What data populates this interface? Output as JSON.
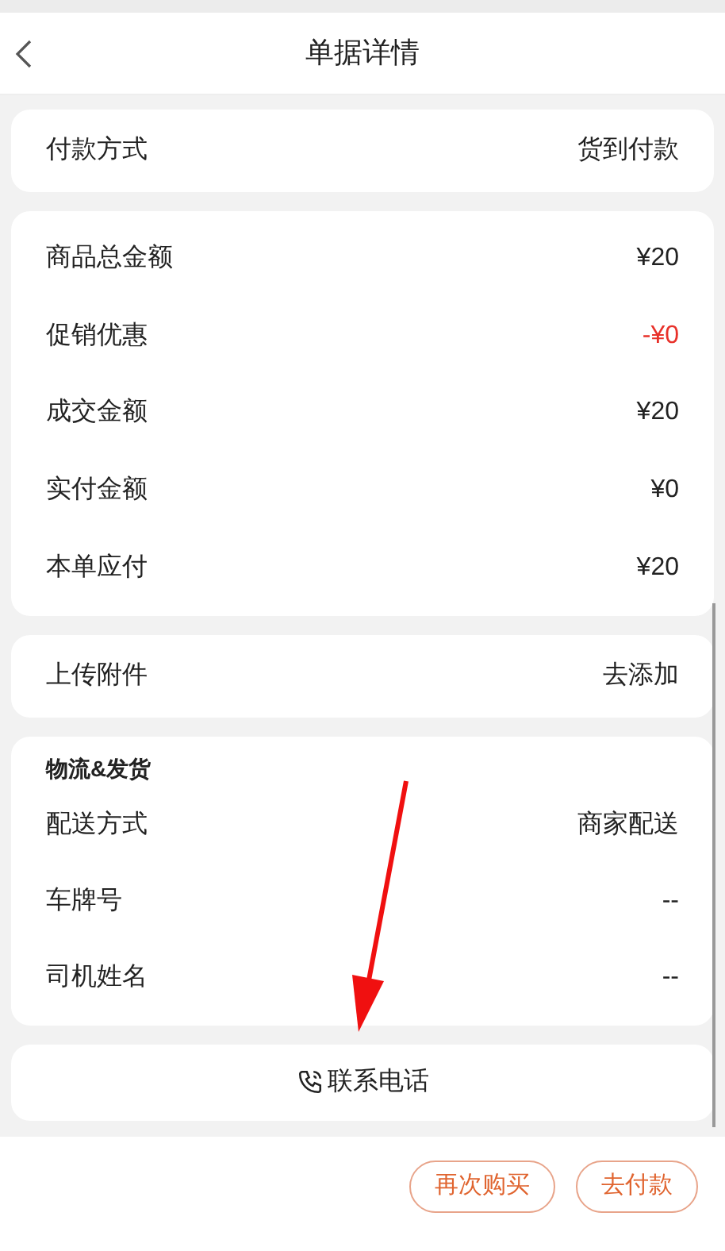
{
  "header": {
    "title": "单据详情"
  },
  "payment": {
    "label": "付款方式",
    "value": "货到付款"
  },
  "amounts": [
    {
      "label": "商品总金额",
      "value": "¥20",
      "kind": "normal"
    },
    {
      "label": "促销优惠",
      "value": "-¥0",
      "kind": "discount"
    },
    {
      "label": "成交金额",
      "value": "¥20",
      "kind": "normal"
    },
    {
      "label": "实付金额",
      "value": "¥0",
      "kind": "normal"
    },
    {
      "label": "本单应付",
      "value": "¥20",
      "kind": "normal"
    }
  ],
  "attachment": {
    "label": "上传附件",
    "value": "去添加"
  },
  "logistics": {
    "title": "物流&发货",
    "rows": [
      {
        "label": "配送方式",
        "value": "商家配送"
      },
      {
        "label": "车牌号",
        "value": "--"
      },
      {
        "label": "司机姓名",
        "value": "--"
      }
    ]
  },
  "contact": {
    "label": "联系电话"
  },
  "buttons": [
    "再次购买",
    "去付款"
  ]
}
